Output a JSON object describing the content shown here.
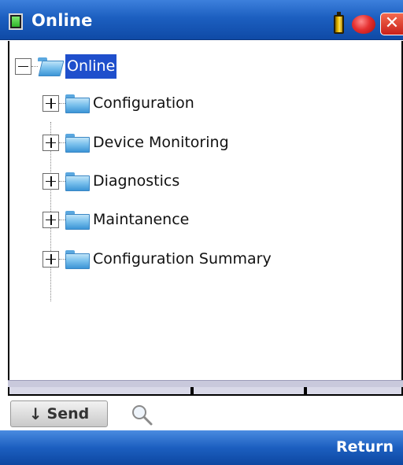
{
  "window": {
    "title": "Online",
    "icons": [
      "app-icon",
      "battery-icon",
      "record-icon",
      "close-icon"
    ],
    "close_glyph": "✕"
  },
  "tree": {
    "root": {
      "label": "Online",
      "expanded": true,
      "selected": true
    },
    "children": [
      {
        "label": "Configuration",
        "expanded": false
      },
      {
        "label": "Device Monitoring",
        "expanded": false
      },
      {
        "label": "Diagnostics",
        "expanded": false
      },
      {
        "label": "Maintanence",
        "expanded": false
      },
      {
        "label": "Configuration Summary",
        "expanded": false
      }
    ]
  },
  "toolbar": {
    "send_label": "Send",
    "send_icon": "down-arrow-icon",
    "search_icon": "magnifier-icon"
  },
  "bottombar": {
    "return_label": "Return"
  },
  "colors": {
    "titlebar": "#1c5fc0",
    "selection": "#1f4fcc",
    "folder": "#7cc2ed"
  }
}
